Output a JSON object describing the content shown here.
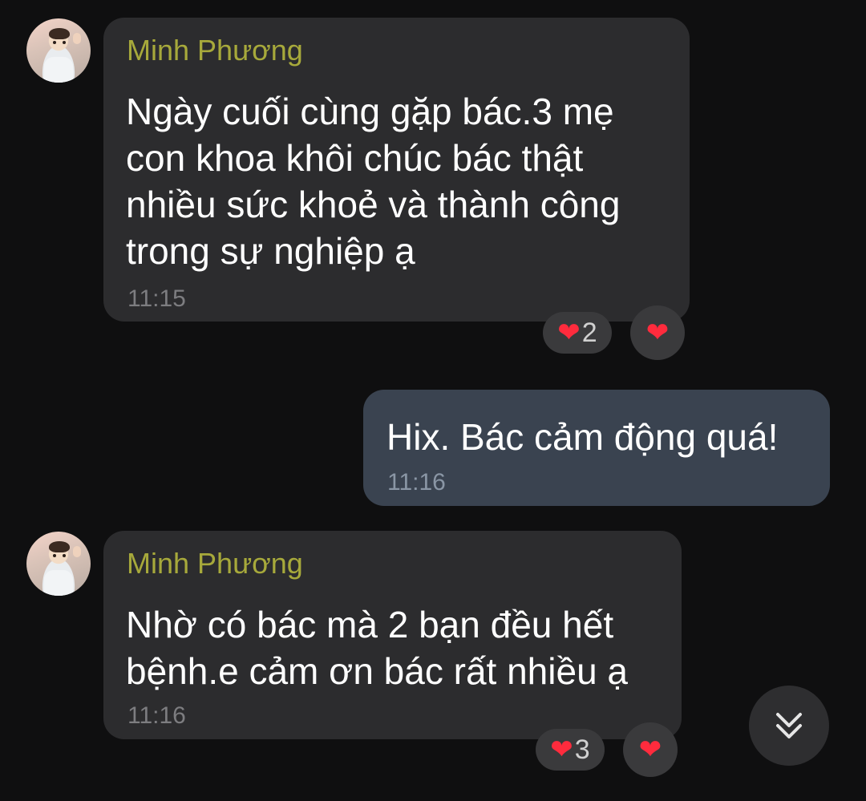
{
  "messages": [
    {
      "sender": "Minh Phương",
      "text": "Ngày cuối cùng gặp bác.3 mẹ\ncon khoa khôi chúc bác thật\nnhiều sức khoẻ và thành công\ntrong sự nghiệp ạ",
      "time": "11:15",
      "reactions": {
        "count": "2",
        "heart_icon": "heart-icon"
      }
    },
    {
      "text": "Hix. Bác cảm động quá!",
      "time": "11:16"
    },
    {
      "sender": "Minh Phương",
      "text": "Nhờ có bác mà 2 bạn đều hết\nbệnh.e cảm ơn bác rất nhiều ạ",
      "time": "11:16",
      "reactions": {
        "count": "3",
        "heart_icon": "heart-icon"
      }
    }
  ],
  "icons": {
    "heart": "❤",
    "scroll_down": "chevron-double-down-icon"
  },
  "colors": {
    "sender_name": "#a7a93b",
    "heart": "#ff2b3d",
    "outgoing_bubble": "#3a4350",
    "incoming_bubble": "#2c2c2e"
  }
}
